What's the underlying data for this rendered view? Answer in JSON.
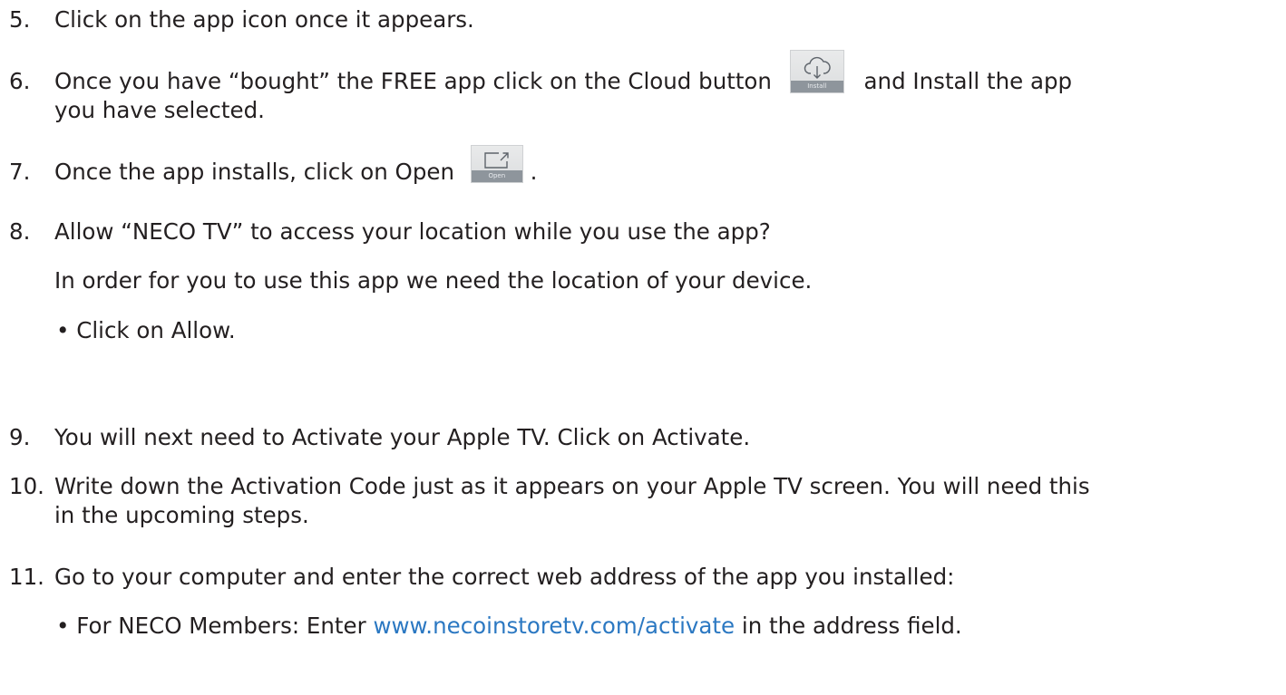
{
  "steps": [
    {
      "number": "5.",
      "text": "Click on the app icon once it appears."
    },
    {
      "number": "6.",
      "text_before": "Once you have “bought” the FREE app click on the Cloud button",
      "text_after": "and Install the app",
      "line2": "you have selected.",
      "button_caption": "Install",
      "button_icon": "cloud-download-icon"
    },
    {
      "number": "7.",
      "text_before": "Once the app installs, click on Open",
      "text_after": ".",
      "button_caption": "Open",
      "button_icon": "open-external-icon"
    },
    {
      "number": "8.",
      "text": "Allow “NECO TV” to access your location while you use the app?",
      "paragraph": "In order for you to use this app we need the location of your device.",
      "bullet": "• Click on Allow."
    },
    {
      "number": "9.",
      "text": "You will next need to Activate your Apple TV. Click on Activate."
    },
    {
      "number": "10.",
      "text": "Write down the Activation Code just as it appears on your Apple TV screen. You will need this",
      "line2": "in the upcoming steps."
    },
    {
      "number": "11.",
      "text": "Go to your computer and enter the correct web address of the app you installed:",
      "bullet_before": "• For NECO Members: Enter ",
      "bullet_link": "www.necoinstoretv.com/activate",
      "bullet_after": " in the address field."
    }
  ],
  "colors": {
    "text": "#231f20",
    "link": "#2b78c2"
  }
}
